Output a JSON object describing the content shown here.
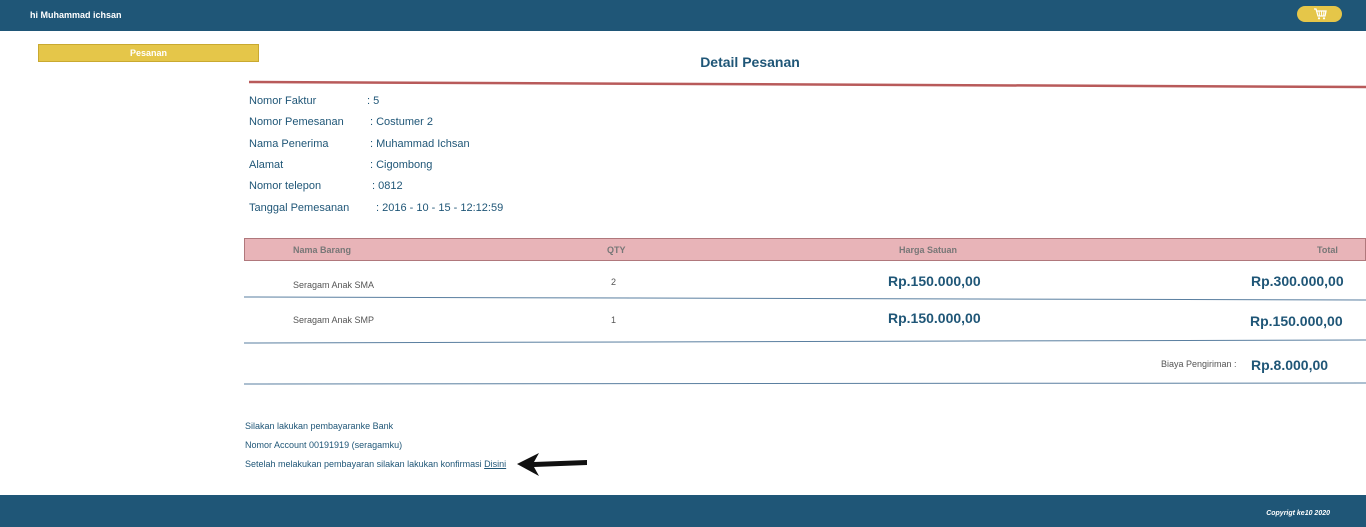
{
  "header": {
    "greeting": "hi Muhammad ichsan",
    "cart_icon": "cart-icon"
  },
  "sidebar": {
    "orders_label": "Pesanan"
  },
  "main": {
    "title": "Detail Pesanan",
    "info": [
      {
        "label": "Nomor Faktur",
        "value": ": 5"
      },
      {
        "label": "Nomor Pemesanan",
        "value": ": Costumer 2"
      },
      {
        "label": "Nama Penerima",
        "value": ": Muhammad Ichsan"
      },
      {
        "label": "Alamat",
        "value": ": Cigombong"
      },
      {
        "label": "Nomor telepon",
        "value": ": 0812"
      },
      {
        "label": "Tanggal Pemesanan",
        "value": ": 2016 - 10 - 15 - 12:12:59"
      }
    ],
    "table": {
      "headers": [
        "Nama Barang",
        "QTY",
        "Harga Satuan",
        "Total"
      ],
      "rows": [
        {
          "name": "Seragam Anak SMA",
          "qty": "2",
          "price": "Rp.150.000,00",
          "total": "Rp.300.000,00"
        },
        {
          "name": "Seragam Anak SMP",
          "qty": "1",
          "price": "Rp.150.000,00",
          "total": "Rp.150.000,00"
        }
      ],
      "shipping_label": "Biaya Pengiriman :",
      "shipping_value": "Rp.8.000,00"
    },
    "notes": {
      "line1": "Silakan lakukan pembayaranke Bank",
      "line2": "Nomor Account 00191919 (seragamku)",
      "line3_text": "Setelah melakukan pembayaran silakan lakukan konfirmasi ",
      "line3_link": "Disini"
    }
  },
  "footer": {
    "copyright": "Copyrigt ke10 2020"
  },
  "colors": {
    "primary": "#1f5677",
    "accent": "#e5c649",
    "table_header": "#e8b4b8",
    "divider": "#b85a5a"
  }
}
